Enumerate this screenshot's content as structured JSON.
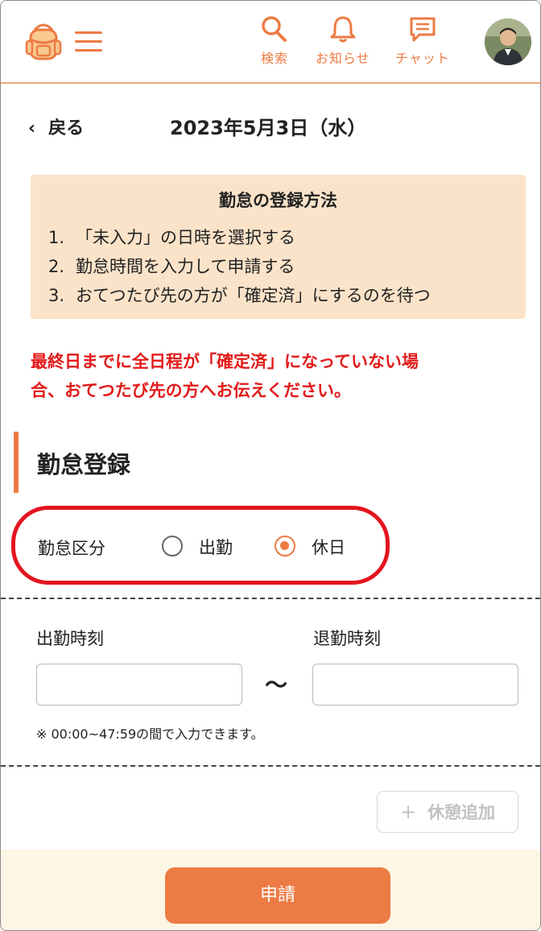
{
  "header": {
    "search_label": "検索",
    "notice_label": "お知らせ",
    "chat_label": "チャット",
    "accent_color": "#ed7a43"
  },
  "nav": {
    "back_label": "戻る",
    "date_title": "2023年5月3日（水）"
  },
  "info": {
    "title": "勤怠の登録方法",
    "steps": [
      {
        "num": "1.",
        "text": "「未入力」の日時を選択する"
      },
      {
        "num": "2.",
        "text": "勤怠時間を入力して申請する"
      },
      {
        "num": "3.",
        "text": "おてつたび先の方が「確定済」にするのを待つ"
      }
    ]
  },
  "warning": {
    "line1": "最終日までに全日程が「確定済」になっていない場",
    "line2": "合、おてつたび先の方へお伝えください。",
    "color": "#e21a1a"
  },
  "form": {
    "section_title": "勤怠登録",
    "category_label": "勤怠区分",
    "options": [
      {
        "label": "出勤",
        "selected": false
      },
      {
        "label": "休日",
        "selected": true
      }
    ],
    "start_label": "出勤時刻",
    "end_label": "退勤時刻",
    "start_value": "",
    "end_value": "",
    "tilde": "～",
    "note": "※ 00:00~47:59の間で入力できます。",
    "add_break_label": "休憩追加",
    "add_break_icon": "+"
  },
  "footer": {
    "submit_label": "申請"
  }
}
